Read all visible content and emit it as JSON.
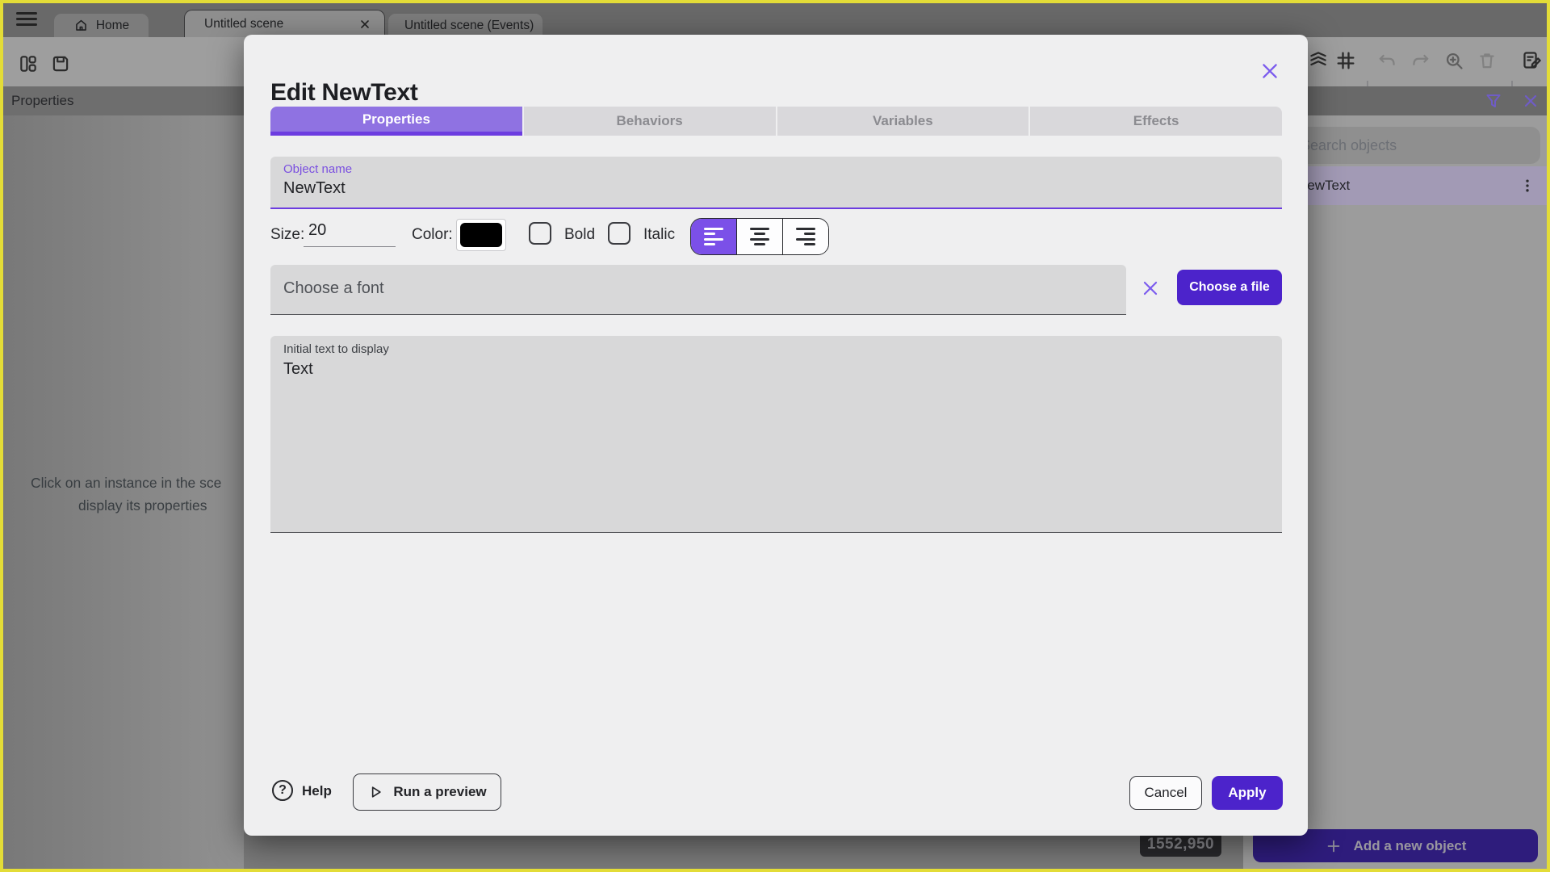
{
  "colors": {
    "accent_purple": "#8f72e2",
    "accent_purple_dark": "#6c3ce0",
    "button_indigo": "#4c23cb",
    "icon_purple": "#7b5bee",
    "selection_row": "#a29ab5",
    "frame_border": "#e3dc37"
  },
  "tabbar": {
    "home_label": "Home",
    "scene_tab": "Untitled scene",
    "events_tab": "Untitled scene (Events)"
  },
  "left_panel": {
    "header": "Properties",
    "hint_line1": "Click on an instance in the sce",
    "hint_line2": "display its properties"
  },
  "right_panel": {
    "search_placeholder": "Search objects",
    "object_item": "NewText",
    "add_button_label": "Add a new object"
  },
  "canvas": {
    "coords_badge": "1552,950"
  },
  "dialog": {
    "title": "Edit NewText",
    "tabs": {
      "properties": "Properties",
      "behaviors": "Behaviors",
      "variables": "Variables",
      "effects": "Effects"
    },
    "object_name_label": "Object name",
    "object_name_value": "NewText",
    "size_label": "Size:",
    "size_value": "20",
    "color_label": "Color:",
    "bold_label": "Bold",
    "italic_label": "Italic",
    "font_placeholder": "Choose a font",
    "choose_file_label": "Choose a file",
    "initial_text_label": "Initial text to display",
    "initial_text_value": "Text",
    "help_label": "Help",
    "run_preview_label": "Run a preview",
    "cancel_label": "Cancel",
    "apply_label": "Apply"
  }
}
